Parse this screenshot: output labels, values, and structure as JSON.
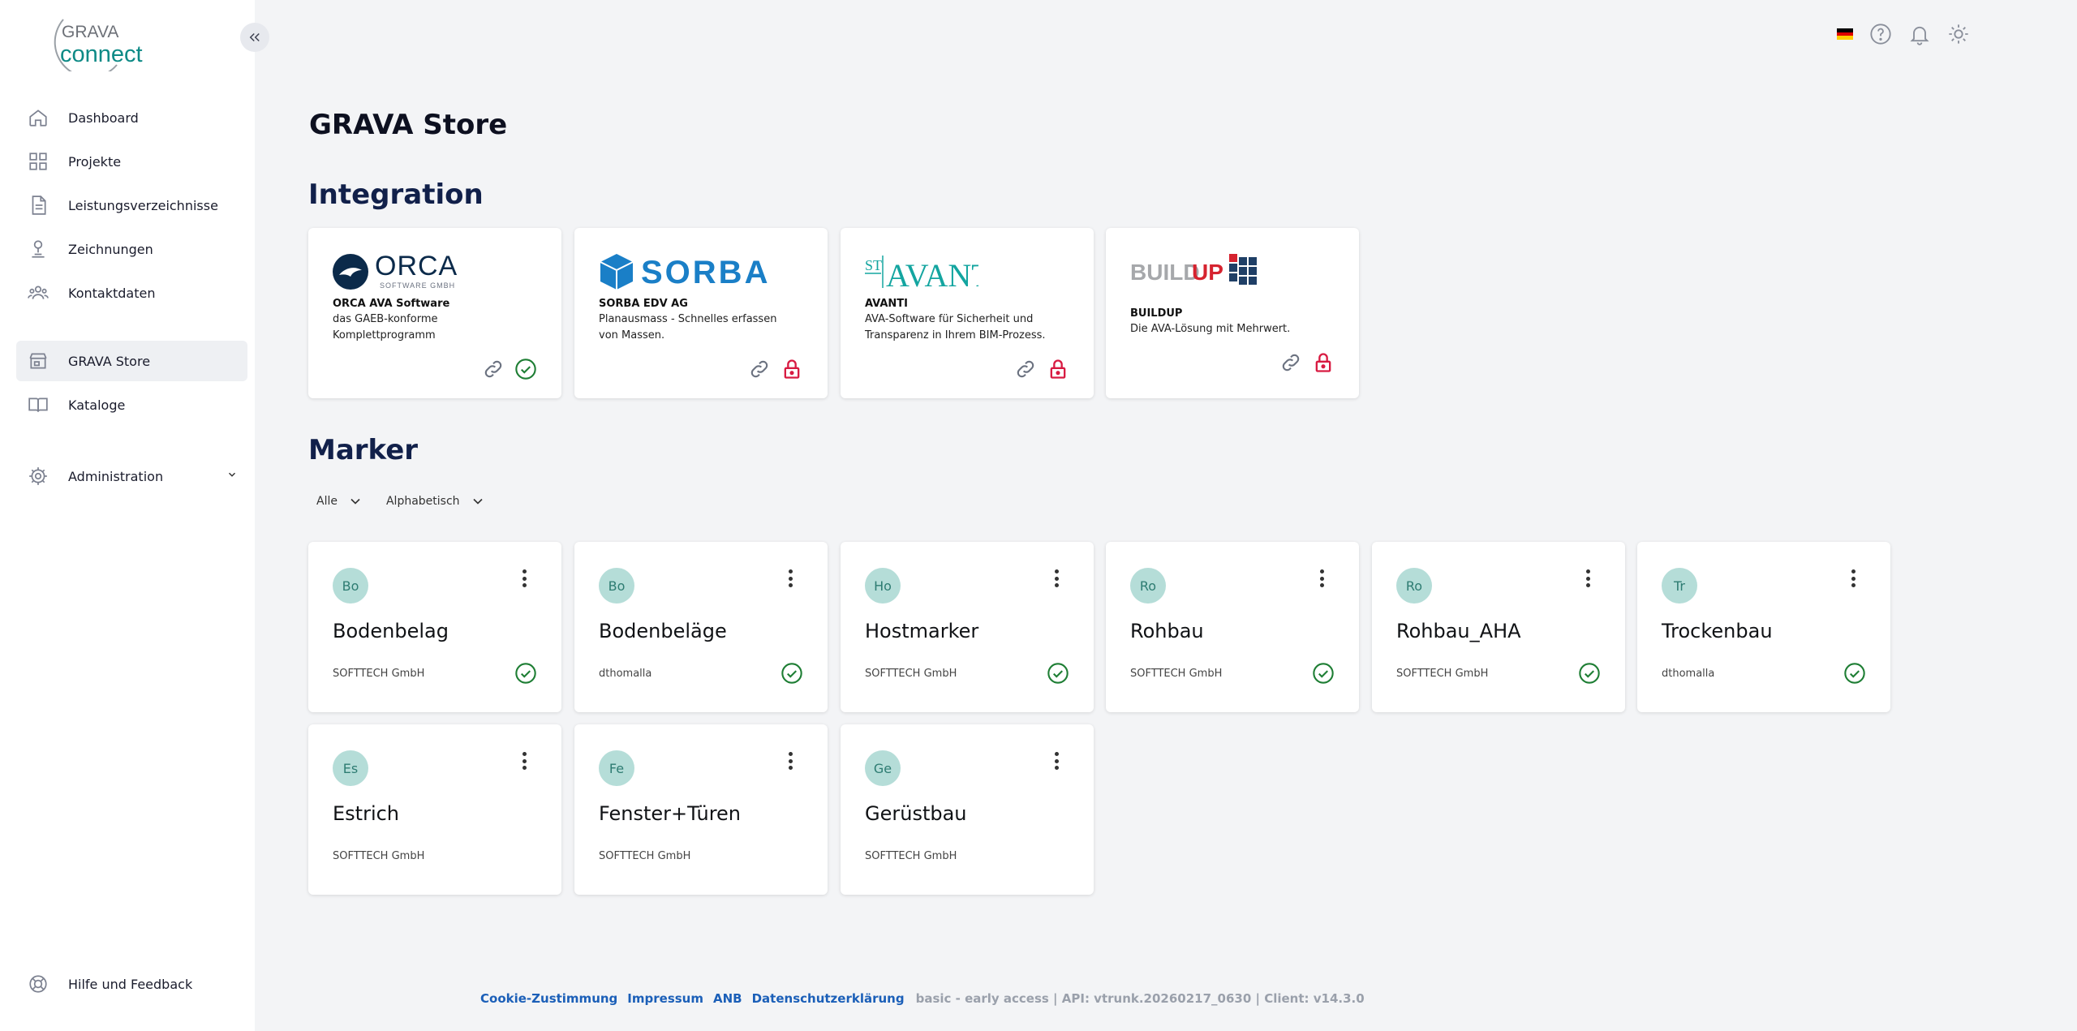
{
  "brand": {
    "line1": "GRAVA",
    "line2": "connect"
  },
  "sidebar": {
    "items": [
      {
        "label": "Dashboard",
        "icon": "home-icon"
      },
      {
        "label": "Projekte",
        "icon": "grid-icon"
      },
      {
        "label": "Leistungsverzeichnisse",
        "icon": "document-icon"
      },
      {
        "label": "Zeichnungen",
        "icon": "drawing-icon"
      },
      {
        "label": "Kontaktdaten",
        "icon": "contacts-icon"
      },
      {
        "label": "GRAVA Store",
        "icon": "store-icon"
      },
      {
        "label": "Kataloge",
        "icon": "book-icon"
      },
      {
        "label": "Administration",
        "icon": "gear-icon"
      }
    ],
    "help_label": "Hilfe und Feedback"
  },
  "page": {
    "title": "GRAVA Store"
  },
  "integration": {
    "title": "Integration",
    "cards": [
      {
        "logo": "ORCA",
        "logo_sub": "SOFTWARE GMBH",
        "name": "ORCA AVA Software",
        "desc": "das GAEB-konforme Komplettprogramm",
        "status": "active"
      },
      {
        "logo": "SORBA",
        "name": "SORBA EDV AG",
        "desc": "Planausmass - Schnelles erfassen von Massen.",
        "status": "locked"
      },
      {
        "logo": "AVANTI",
        "logo_prefix": "ST",
        "name": "AVANTI",
        "desc": "AVA-Software für Sicherheit und Transparenz in Ihrem BIM-Prozess.",
        "status": "locked"
      },
      {
        "logo": "BUILD",
        "logo_accent": "UP",
        "name": "BUILDUP",
        "desc": "Die AVA-Lösung mit Mehrwert.",
        "status": "locked"
      }
    ]
  },
  "marker": {
    "title": "Marker",
    "filter_all": "Alle",
    "filter_sort": "Alphabetisch",
    "cards": [
      {
        "initials": "Bo",
        "title": "Bodenbelag",
        "owner": "SOFTTECH GmbH",
        "active": true
      },
      {
        "initials": "Bo",
        "title": "Bodenbeläge",
        "owner": "dthomalla",
        "active": true
      },
      {
        "initials": "Ho",
        "title": "Hostmarker",
        "owner": "SOFTTECH GmbH",
        "active": true
      },
      {
        "initials": "Ro",
        "title": "Rohbau",
        "owner": "SOFTTECH GmbH",
        "active": true
      },
      {
        "initials": "Ro",
        "title": "Rohbau_AHA",
        "owner": "SOFTTECH GmbH",
        "active": true
      },
      {
        "initials": "Tr",
        "title": "Trockenbau",
        "owner": "dthomalla",
        "active": true
      },
      {
        "initials": "Es",
        "title": "Estrich",
        "owner": "SOFTTECH GmbH",
        "active": false
      },
      {
        "initials": "Fe",
        "title": "Fenster+Türen",
        "owner": "SOFTTECH GmbH",
        "active": false
      },
      {
        "initials": "Ge",
        "title": "Gerüstbau",
        "owner": "SOFTTECH GmbH",
        "active": false
      }
    ]
  },
  "footer": {
    "links": [
      "Cookie-Zustimmung",
      "Impressum",
      "ANB",
      "Datenschutzerklärung"
    ],
    "version": "basic - early access | API: vtrunk.20260217_0630 | Client: v14.3.0"
  },
  "colors": {
    "accent": "#0e8a86",
    "danger": "#d81b42",
    "success": "#1e7e34",
    "avatar_bg": "#b5ddd8"
  }
}
